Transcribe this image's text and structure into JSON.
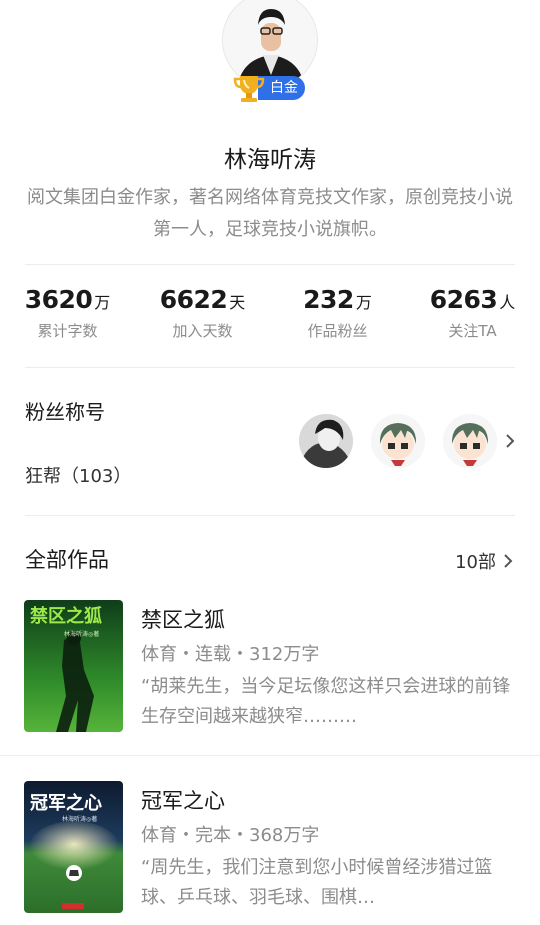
{
  "profile": {
    "name": "林海听涛",
    "badge": "白金",
    "intro": "阅文集团白金作家，著名网络体育竞技文作家，原创竞技小说第一人，足球竞技小说旗帜。"
  },
  "stats": [
    {
      "value": "3620",
      "unit": "万",
      "label": "累计字数"
    },
    {
      "value": "6622",
      "unit": "天",
      "label": "加入天数"
    },
    {
      "value": "232",
      "unit": "万",
      "label": "作品粉丝"
    },
    {
      "value": "6263",
      "unit": "人",
      "label": "关注TA"
    }
  ],
  "fans": {
    "title": "粉丝称号",
    "group": "狂帮（103）"
  },
  "works": {
    "title": "全部作品",
    "count": "10部",
    "books": [
      {
        "title": "禁区之狐",
        "meta": "体育・连载・312万字",
        "desc": "“胡莱先生，当今足坛像您这样只会进球的前锋生存空间越来越狭窄………",
        "cover_title": "禁区之狐",
        "cover_author": "林海听涛◎著"
      },
      {
        "title": "冠军之心",
        "meta": "体育・完本・368万字",
        "desc": "“周先生，我们注意到您小时候曾经涉猎过篮球、乒乓球、羽毛球、围棋…",
        "cover_title": "冠军之心",
        "cover_author": "林海听涛◎著"
      }
    ]
  },
  "colors": {
    "accent_blue": "#2f6fe8",
    "gold": "#f2b01e",
    "secondary_text": "#8c8c8c"
  }
}
